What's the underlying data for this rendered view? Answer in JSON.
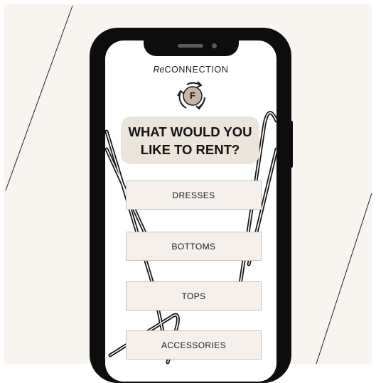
{
  "app": {
    "brand_prefix": "Re",
    "brand_suffix": "CONNECTION",
    "logo_letter": "F"
  },
  "question": {
    "line1": "WHAT WOULD YOU",
    "line2": "LIKE TO RENT?"
  },
  "categories": [
    {
      "label": "DRESSES"
    },
    {
      "label": "BOTTOMS"
    },
    {
      "label": "TOPS"
    },
    {
      "label": "ACCESSORIES"
    }
  ],
  "colors": {
    "background": "#f8f4f0",
    "phone_frame": "#0d0d0d",
    "question_bg": "#ebe4db",
    "button_bg": "#f5f0eb",
    "logo_accent": "#c7b6a8"
  }
}
